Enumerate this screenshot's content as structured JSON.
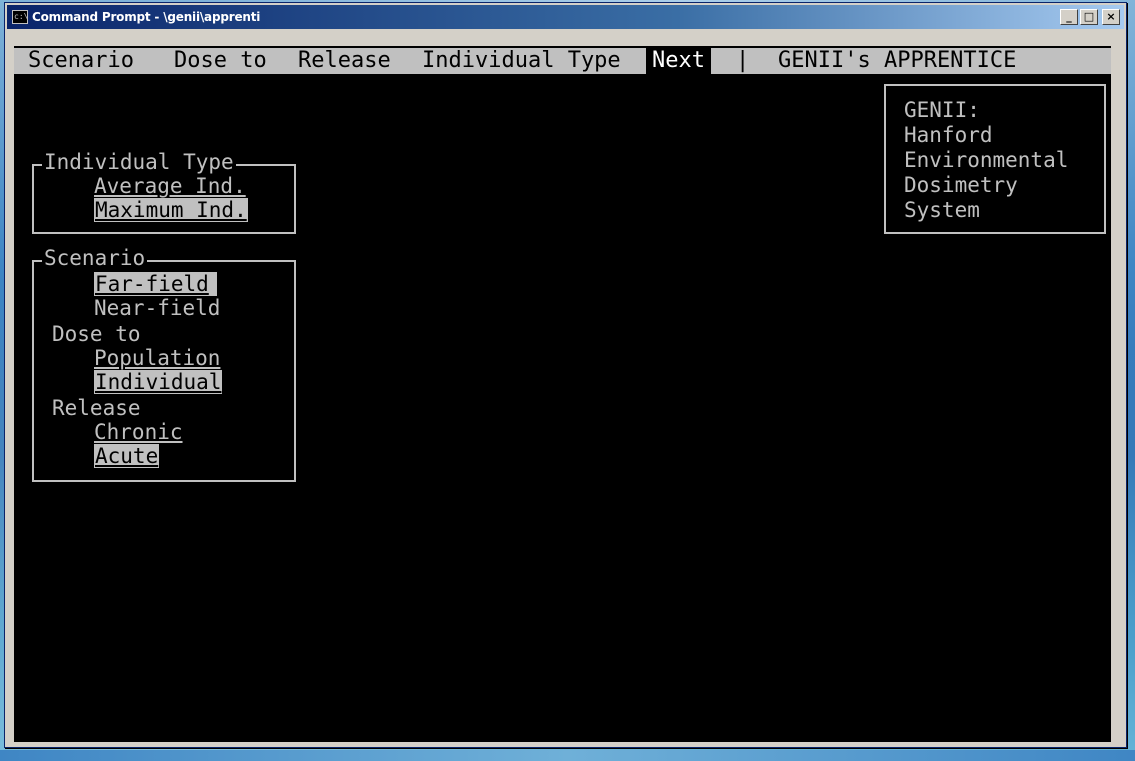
{
  "window": {
    "title": "Command Prompt - \\genii\\apprenti",
    "icon": "console-icon",
    "controls": {
      "minimize": "_",
      "maximize": "□",
      "close": "×"
    }
  },
  "menubar": {
    "items": [
      "Scenario",
      "Dose to",
      "Release",
      "Individual Type",
      "Next"
    ],
    "separator": "|",
    "app_name": "GENII's APPRENTICE",
    "active_item": "Next"
  },
  "individual_type_box": {
    "title": "Individual Type",
    "options": [
      "Average Ind.",
      "Maximum Ind."
    ],
    "selected": "Maximum Ind."
  },
  "scenario_box": {
    "title": "Scenario",
    "scenario_options": [
      "Far-field",
      "Near-field"
    ],
    "scenario_selected": "Far-field",
    "dose_to_label": "Dose to",
    "dose_to_options": [
      "Population",
      "Individual"
    ],
    "dose_to_selected": "Individual",
    "release_label": "Release",
    "release_options": [
      "Chronic",
      "Acute"
    ],
    "release_selected": "Acute"
  },
  "info_box": {
    "lines": [
      "GENII:",
      "Hanford",
      "Environmental",
      "Dosimetry",
      "System"
    ]
  },
  "colors": {
    "console_bg": "#000000",
    "console_fg": "#c0c0c0",
    "menu_bg": "#c0c0c0",
    "title_bar": "#0a246a"
  }
}
